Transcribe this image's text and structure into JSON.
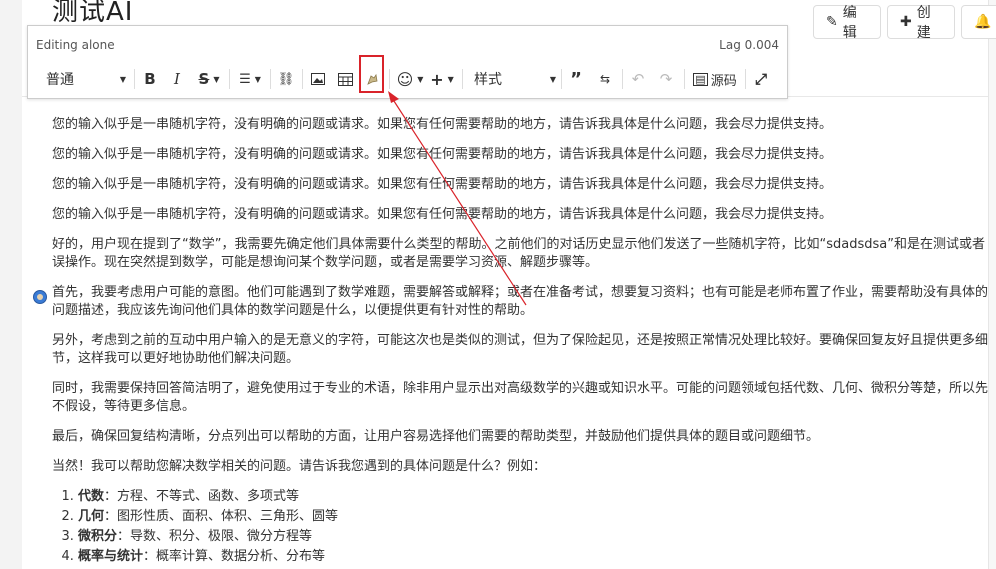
{
  "page": {
    "title": "测试AI"
  },
  "header": {
    "edit_label": "编辑",
    "create_label": "创建"
  },
  "toolbar": {
    "status": "Editing alone",
    "lag": "Lag 0.004",
    "format_select": "普通",
    "style_select": "样式",
    "source_label": "源码"
  },
  "content": {
    "paragraphs": [
      "您的输入似乎是一串随机字符，没有明确的问题或请求。如果您有任何需要帮助的地方，请告诉我具体是什么问题，我会尽力提供支持。",
      "您的输入似乎是一串随机字符，没有明确的问题或请求。如果您有任何需要帮助的地方，请告诉我具体是什么问题，我会尽力提供支持。",
      "您的输入似乎是一串随机字符，没有明确的问题或请求。如果您有任何需要帮助的地方，请告诉我具体是什么问题，我会尽力提供支持。",
      "您的输入似乎是一串随机字符，没有明确的问题或请求。如果您有任何需要帮助的地方，请告诉我具体是什么问题，我会尽力提供支持。",
      "好的，用户现在提到了“数学”，我需要先确定他们具体需要什么类型的帮助。之前他们的对话历史显示他们发送了一些随机字符，比如“sdadsdsa”和是在测试或者误操作。现在突然提到数学，可能是想询问某个数学问题，或者是需要学习资源、解题步骤等。",
      "首先，我要考虑用户可能的意图。他们可能遇到了数学难题，需要解答或解释；或者在准备考试，想要复习资料；也有可能是老师布置了作业，需要帮助没有具体的问题描述，我应该先询问他们具体的数学问题是什么，以便提供更有针对性的帮助。",
      "另外，考虑到之前的互动中用户输入的是无意义的字符，可能这次也是类似的测试，但为了保险起见，还是按照正常情况处理比较好。要确保回复友好且提供更多细节，这样我可以更好地协助他们解决问题。",
      "同时，我需要保持回答简洁明了，避免使用过于专业的术语，除非用户显示出对高级数学的兴趣或知识水平。可能的问题领域包括代数、几何、微积分等楚，所以先不假设，等待更多信息。",
      "最后，确保回复结构清晰，分点列出可以帮助的方面，让用户容易选择他们需要的帮助类型，并鼓励他们提供具体的题目或问题细节。",
      "当然！我可以帮助您解决数学相关的问题。请告诉我您遇到的具体问题是什么？例如："
    ],
    "list": [
      {
        "term": "代数",
        "desc": "：方程、不等式、函数、多项式等"
      },
      {
        "term": "几何",
        "desc": "：图形性质、面积、体积、三角形、圆等"
      },
      {
        "term": "微积分",
        "desc": "：导数、积分、极限、微分方程等"
      },
      {
        "term": "概率与统计",
        "desc": "：概率计算、数据分析、分布等"
      }
    ]
  }
}
